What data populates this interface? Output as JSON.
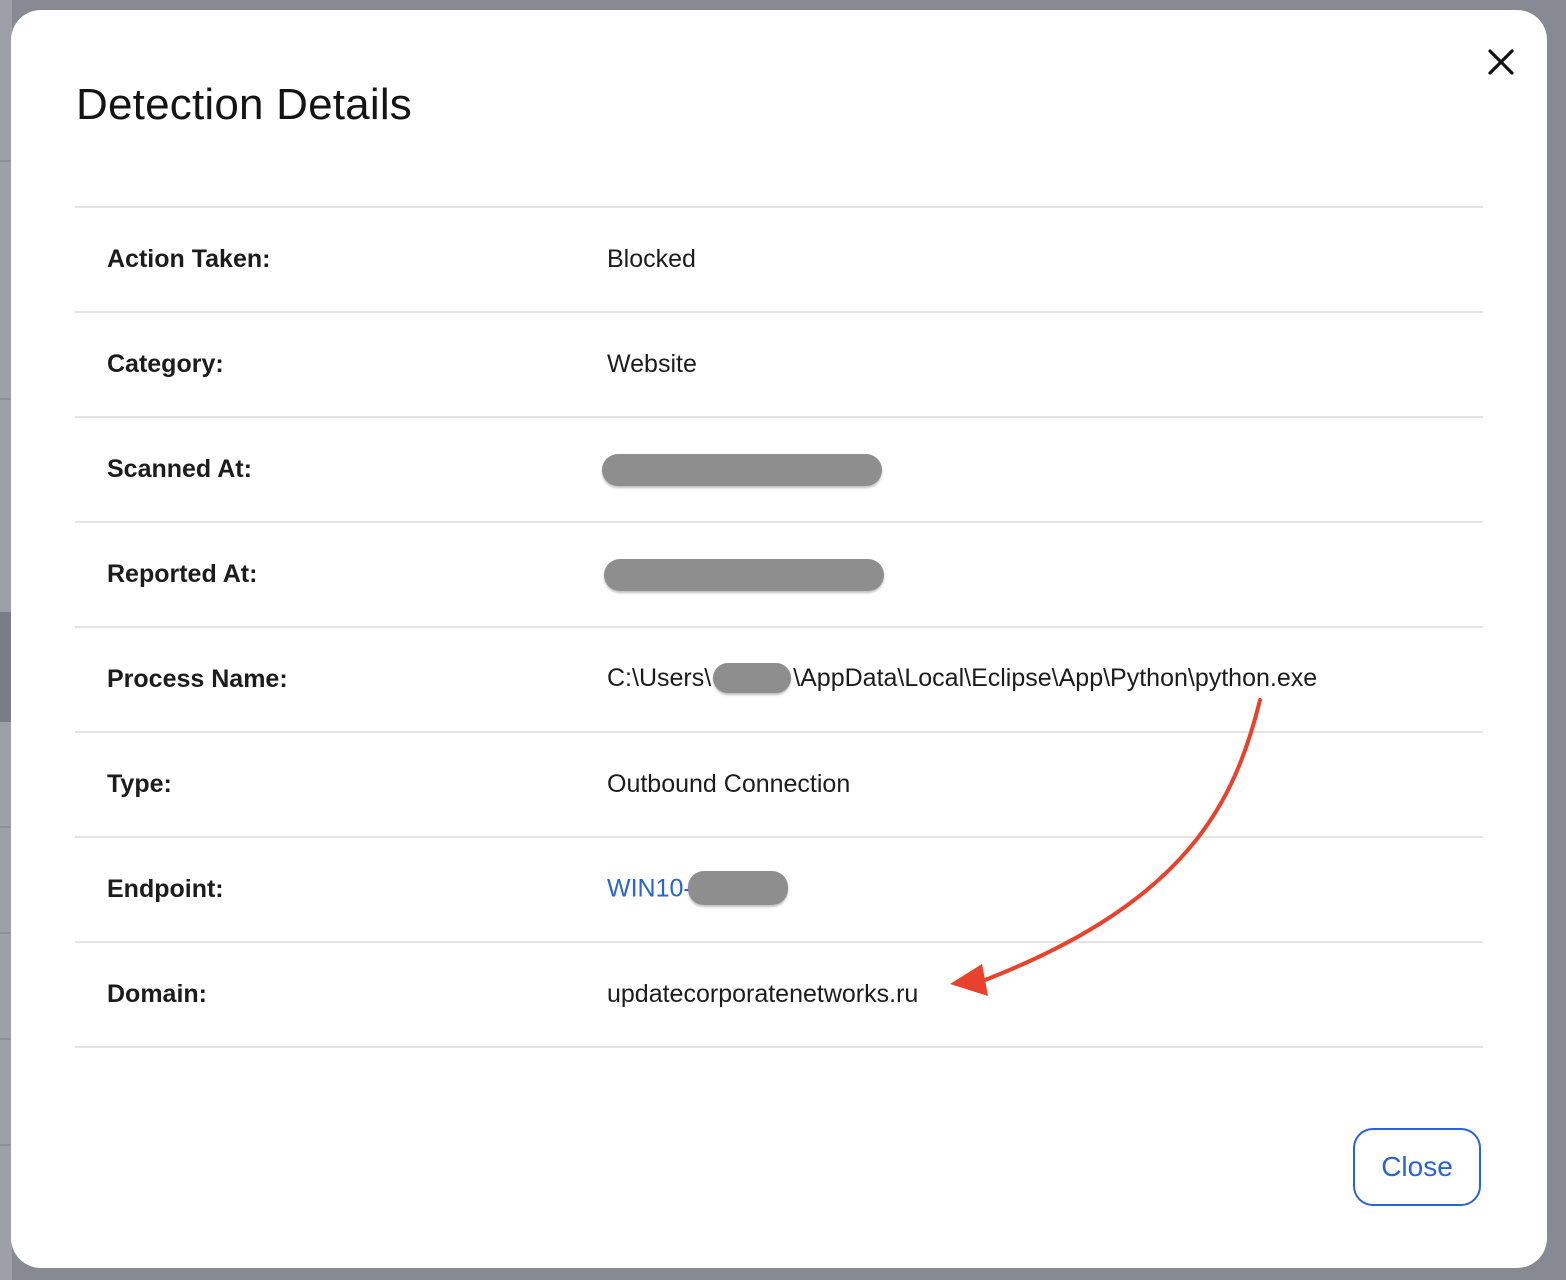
{
  "modal": {
    "title": "Detection Details",
    "close_label": "Close"
  },
  "details": [
    {
      "label": "Action Taken:",
      "value": "Blocked"
    },
    {
      "label": "Category:",
      "value": "Website"
    },
    {
      "label": "Scanned At:",
      "value": ""
    },
    {
      "label": "Reported At:",
      "value": ""
    },
    {
      "label": "Process Name:",
      "value_prefix": "C:\\Users\\",
      "value_suffix": "\\AppData\\Local\\Eclipse\\App\\Python\\python.exe"
    },
    {
      "label": "Type:",
      "value": "Outbound Connection"
    },
    {
      "label": "Endpoint:",
      "value_prefix": "WIN10-"
    },
    {
      "label": "Domain:",
      "value": "updatecorporatenetworks.ru"
    }
  ],
  "icons": {
    "close": "close-x-icon"
  },
  "colors": {
    "link": "#2a63d6",
    "annotation_arrow": "#e8412c"
  }
}
